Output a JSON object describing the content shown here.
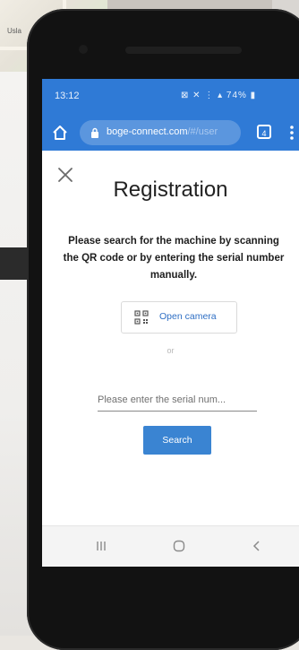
{
  "background": {
    "map_label": "Usla"
  },
  "status_bar": {
    "time": "13:12",
    "indicators": "⊠ ✕ ⋮ ▴ 74% ▮"
  },
  "browser": {
    "url_domain": "boge-connect.com",
    "url_path": "/#/user",
    "tab_count": "4"
  },
  "registration": {
    "title": "Registration",
    "instructions": "Please search for the machine by scanning the QR code or by entering the serial number manually.",
    "open_camera_label": "Open camera",
    "or_label": "or",
    "serial_placeholder": "Please enter the serial num...",
    "serial_value": "",
    "search_label": "Search"
  },
  "colors": {
    "accent": "#2f7ad6",
    "button": "#3a84d2",
    "link": "#2f6fc4"
  },
  "icons": {
    "close": "close-icon",
    "home": "home-icon",
    "lock": "lock-icon",
    "qr": "qr-code-icon",
    "menu": "more-vertical-icon",
    "nav_recent": "recent-apps-icon",
    "nav_home": "home-circle-icon",
    "nav_back": "back-chevron-icon"
  }
}
